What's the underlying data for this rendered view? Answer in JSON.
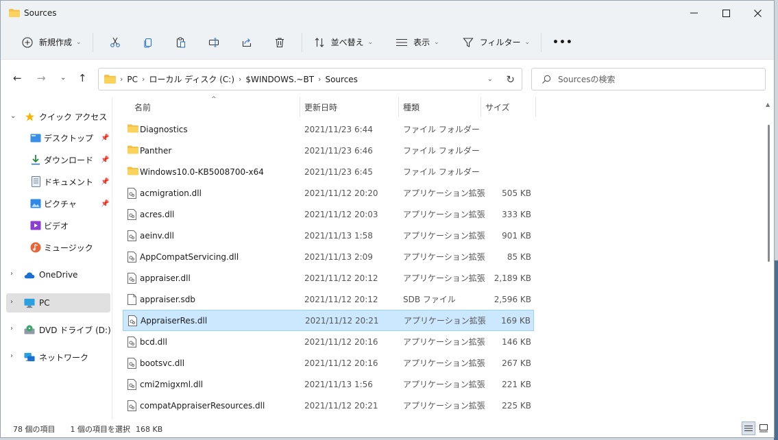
{
  "window": {
    "title": "Sources"
  },
  "toolbar": {
    "new_label": "新規作成",
    "sort_label": "並べ替え",
    "view_label": "表示",
    "filter_label": "フィルター",
    "more_label": "•••"
  },
  "address": {
    "crumbs": [
      "PC",
      "ローカル ディスク (C:)",
      "$WINDOWS.~BT",
      "Sources"
    ]
  },
  "search": {
    "placeholder": "Sourcesの検索"
  },
  "sidebar": {
    "quick_access": "クイック アクセス",
    "items": [
      "デスクトップ",
      "ダウンロード",
      "ドキュメント",
      "ピクチャ",
      "ビデオ",
      "ミュージック"
    ],
    "onedrive": "OneDrive",
    "pc": "PC",
    "dvd": "DVD ドライブ (D:) CPR",
    "network": "ネットワーク"
  },
  "columns": {
    "name": "名前",
    "date": "更新日時",
    "type": "種類",
    "size": "サイズ"
  },
  "files": [
    {
      "name": "Diagnostics",
      "date": "2021/11/23 6:44",
      "type": "ファイル フォルダー",
      "size": "",
      "kind": "folder"
    },
    {
      "name": "Panther",
      "date": "2021/11/23 6:46",
      "type": "ファイル フォルダー",
      "size": "",
      "kind": "folder"
    },
    {
      "name": "Windows10.0-KB5008700-x64",
      "date": "2021/11/23 6:45",
      "type": "ファイル フォルダー",
      "size": "",
      "kind": "folder"
    },
    {
      "name": "acmigration.dll",
      "date": "2021/11/12 20:20",
      "type": "アプリケーション拡張",
      "size": "505 KB",
      "kind": "dll"
    },
    {
      "name": "acres.dll",
      "date": "2021/11/12 20:03",
      "type": "アプリケーション拡張",
      "size": "333 KB",
      "kind": "dll"
    },
    {
      "name": "aeinv.dll",
      "date": "2021/11/13 1:58",
      "type": "アプリケーション拡張",
      "size": "901 KB",
      "kind": "dll"
    },
    {
      "name": "AppCompatServicing.dll",
      "date": "2021/11/13 2:09",
      "type": "アプリケーション拡張",
      "size": "85 KB",
      "kind": "dll"
    },
    {
      "name": "appraiser.dll",
      "date": "2021/11/12 20:12",
      "type": "アプリケーション拡張",
      "size": "2,189 KB",
      "kind": "dll"
    },
    {
      "name": "appraiser.sdb",
      "date": "2021/11/12 20:12",
      "type": "SDB ファイル",
      "size": "2,596 KB",
      "kind": "file"
    },
    {
      "name": "AppraiserRes.dll",
      "date": "2021/11/12 20:21",
      "type": "アプリケーション拡張",
      "size": "169 KB",
      "kind": "dll",
      "selected": true
    },
    {
      "name": "bcd.dll",
      "date": "2021/11/12 20:16",
      "type": "アプリケーション拡張",
      "size": "146 KB",
      "kind": "dll"
    },
    {
      "name": "bootsvc.dll",
      "date": "2021/11/12 20:16",
      "type": "アプリケーション拡張",
      "size": "267 KB",
      "kind": "dll"
    },
    {
      "name": "cmi2migxml.dll",
      "date": "2021/11/13 1:56",
      "type": "アプリケーション拡張",
      "size": "221 KB",
      "kind": "dll"
    },
    {
      "name": "compatAppraiserResources.dll",
      "date": "2021/11/12 20:21",
      "type": "アプリケーション拡張",
      "size": "225 KB",
      "kind": "dll"
    }
  ],
  "status": {
    "count": "78 個の項目",
    "selection": "1 個の項目を選択",
    "selected_size": "168 KB"
  }
}
